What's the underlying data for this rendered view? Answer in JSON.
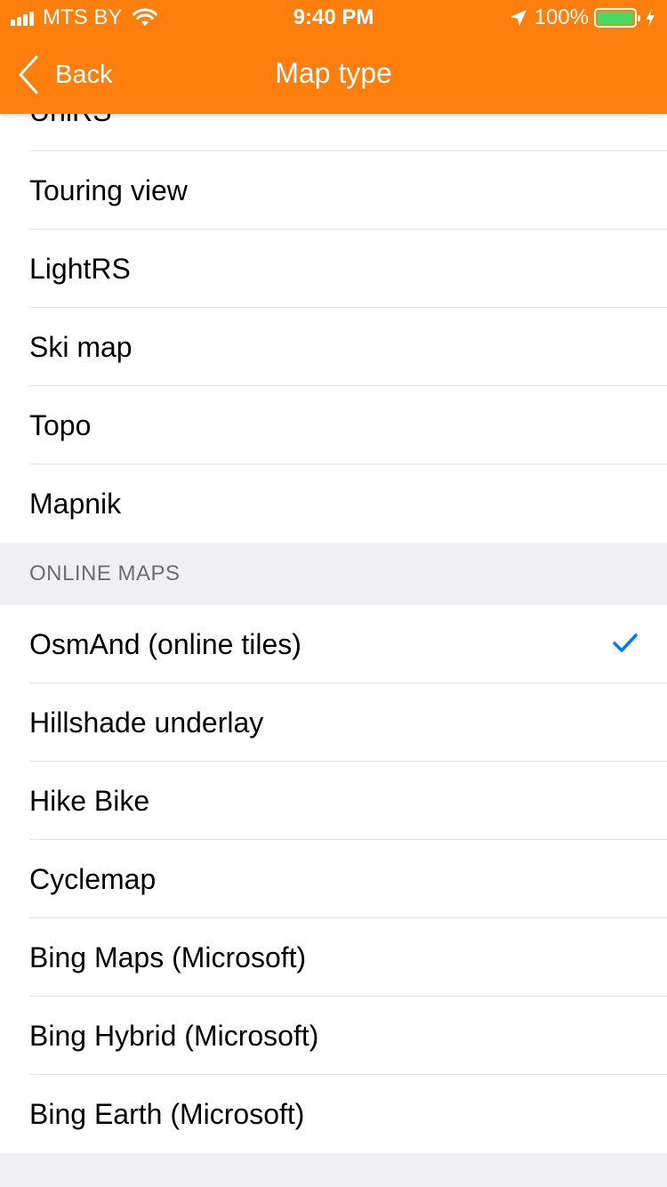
{
  "status_bar": {
    "carrier": "MTS BY",
    "time": "9:40 PM",
    "battery": "100%"
  },
  "nav": {
    "back_label": "Back",
    "title": "Map type"
  },
  "offline_items": [
    {
      "label": "UniRS"
    },
    {
      "label": "Touring view"
    },
    {
      "label": "LightRS"
    },
    {
      "label": "Ski map"
    },
    {
      "label": "Topo"
    },
    {
      "label": "Mapnik"
    }
  ],
  "online_section": {
    "header": "ONLINE MAPS",
    "items": [
      {
        "label": "OsmAnd (online tiles)",
        "selected": true
      },
      {
        "label": "Hillshade underlay"
      },
      {
        "label": "Hike Bike"
      },
      {
        "label": "Cyclemap"
      },
      {
        "label": "Bing Maps (Microsoft)"
      },
      {
        "label": "Bing Hybrid (Microsoft)"
      },
      {
        "label": "Bing Earth (Microsoft)"
      }
    ]
  },
  "colors": {
    "accent": "#ff7f0e",
    "checkmark": "#007aff",
    "battery": "#4cd964"
  }
}
